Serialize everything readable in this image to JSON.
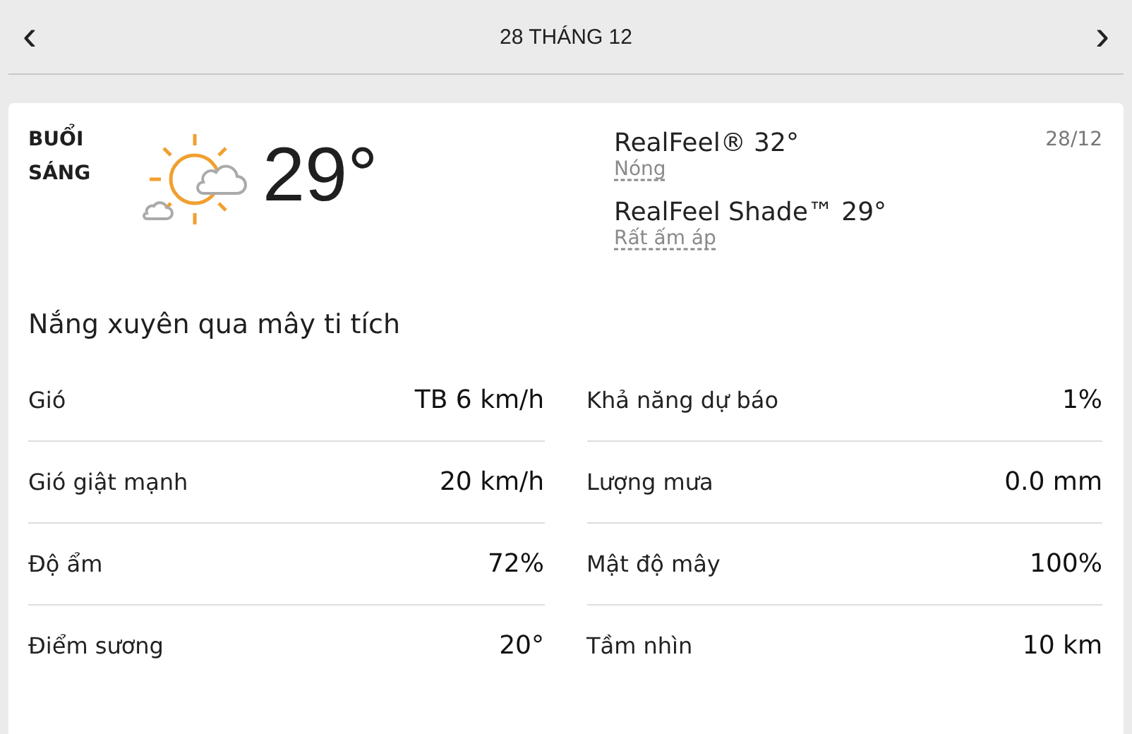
{
  "header": {
    "title": "28 THÁNG 12",
    "prev": "‹",
    "next": "›"
  },
  "card": {
    "period": "BUỔI SÁNG",
    "temperature": "29°",
    "date": "28/12",
    "realfeel": [
      {
        "label": "RealFeel® 32°",
        "note": "Nóng"
      },
      {
        "label": "RealFeel Shade™ 29°",
        "note": "Rất ấm áp"
      }
    ],
    "condition": "Nắng xuyên qua mây ti tích",
    "details_left": [
      {
        "label": "Gió",
        "value": "TB 6 km/h"
      },
      {
        "label": "Gió giật mạnh",
        "value": "20 km/h"
      },
      {
        "label": "Độ ẩm",
        "value": "72%"
      },
      {
        "label": "Điểm sương",
        "value": "20°"
      }
    ],
    "details_right": [
      {
        "label": "Khả năng dự báo",
        "value": "1%"
      },
      {
        "label": "Lượng mưa",
        "value": "0.0 mm"
      },
      {
        "label": "Mật độ mây",
        "value": "100%"
      },
      {
        "label": "Tầm nhìn",
        "value": "10 km"
      }
    ]
  }
}
